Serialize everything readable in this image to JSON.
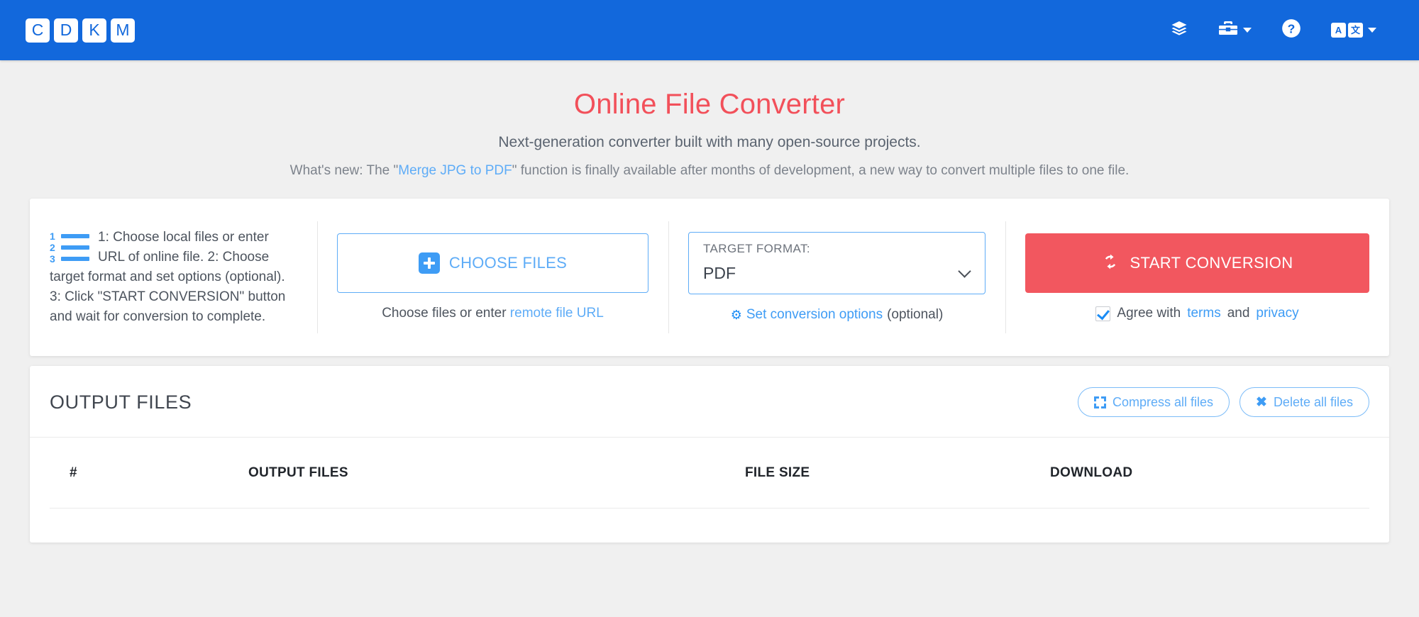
{
  "navbar": {
    "brand_letters": [
      "C",
      "D",
      "K",
      "M"
    ],
    "brand_name": "CDKM",
    "items": [
      {
        "name": "layers-icon",
        "label": ""
      },
      {
        "name": "toolbox-icon",
        "label": ""
      },
      {
        "name": "help-icon",
        "label": ""
      },
      {
        "name": "language-icon",
        "label": ""
      }
    ],
    "language_boxes": [
      "A",
      "文"
    ],
    "accent_color": "#1268dc"
  },
  "hero": {
    "title": "Online File Converter",
    "subtitle": "Next-generation converter built with many open-source projects.",
    "news_prefix": "What's new: The \"",
    "news_link": "Merge JPG to PDF",
    "news_suffix": "\" function is finally available after months of development, a new way to convert multiple files to one file.",
    "title_color": "#f2505a"
  },
  "steps": {
    "instructions": "1: Choose local files or enter URL of online file. 2: Choose target format and set options (optional). 3: Click \"START CONVERSION\" button and wait for conversion to complete.",
    "list_numbers": [
      "1",
      "2",
      "3"
    ],
    "choose_files_label": "CHOOSE FILES",
    "choose_hint_prefix": "Choose files or enter ",
    "choose_hint_link": "remote file URL",
    "target_format_label": "TARGET FORMAT:",
    "target_format_value": "PDF",
    "target_format_options": [
      "PDF"
    ],
    "conversion_options_link": "Set conversion options",
    "conversion_options_suffix": " (optional)",
    "start_conversion_label": "START CONVERSION",
    "agree_prefix": "Agree with ",
    "agree_terms": "terms",
    "agree_middle": " and ",
    "agree_privacy": "privacy",
    "agree_checked": true,
    "start_button_color": "#f2575f"
  },
  "output": {
    "title": "OUTPUT FILES",
    "compress_label": "Compress all files",
    "delete_label": "Delete all files",
    "columns": [
      "#",
      "OUTPUT FILES",
      "FILE SIZE",
      "DOWNLOAD"
    ],
    "rows": []
  }
}
